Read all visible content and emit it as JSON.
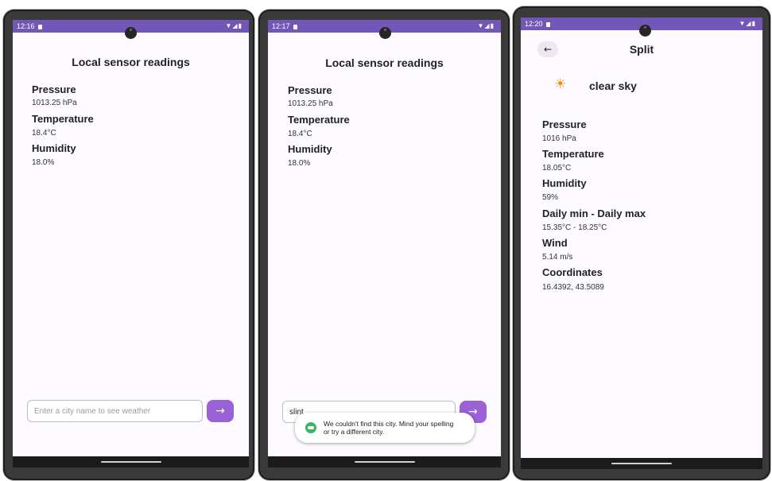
{
  "screen1": {
    "status_time": "12:16",
    "title": "Local sensor readings",
    "readings": [
      {
        "label": "Pressure",
        "value": "1013.25 hPa"
      },
      {
        "label": "Temperature",
        "value": "18.4°C"
      },
      {
        "label": "Humidity",
        "value": "18.0%"
      }
    ],
    "city_input": {
      "value": "",
      "placeholder": "Enter a city name to see weather"
    },
    "go_button_icon": "→"
  },
  "screen2": {
    "status_time": "12:17",
    "title": "Local sensor readings",
    "readings": [
      {
        "label": "Pressure",
        "value": "1013.25 hPa"
      },
      {
        "label": "Temperature",
        "value": "18.4°C"
      },
      {
        "label": "Humidity",
        "value": "18.0%"
      }
    ],
    "city_input": {
      "value": "slint",
      "placeholder": "Enter a city name to see weather"
    },
    "go_button_icon": "→",
    "toast": {
      "message": "We couldn't find this city. Mind your spelling or try a different city."
    }
  },
  "screen3": {
    "status_time": "12:20",
    "back_icon": "←",
    "title": "Split",
    "condition": "clear sky",
    "condition_icon": "☀",
    "fields": [
      {
        "label": "Pressure",
        "value": "1016 hPa"
      },
      {
        "label": "Temperature",
        "value": "18.05°C"
      },
      {
        "label": "Humidity",
        "value": "59%"
      },
      {
        "label": "Daily min - Daily max",
        "value": "15.35°C - 18.25°C"
      },
      {
        "label": "Wind",
        "value": "5.14 m/s"
      },
      {
        "label": "Coordinates",
        "value": "16.4392, 43.5089"
      }
    ]
  },
  "status_icons": "▼◢▮",
  "colors": {
    "status_bar": "#7256b8",
    "accent_button": "#9a62d6",
    "toast_icon": "#3bb56a",
    "sun": "#f08a10"
  }
}
